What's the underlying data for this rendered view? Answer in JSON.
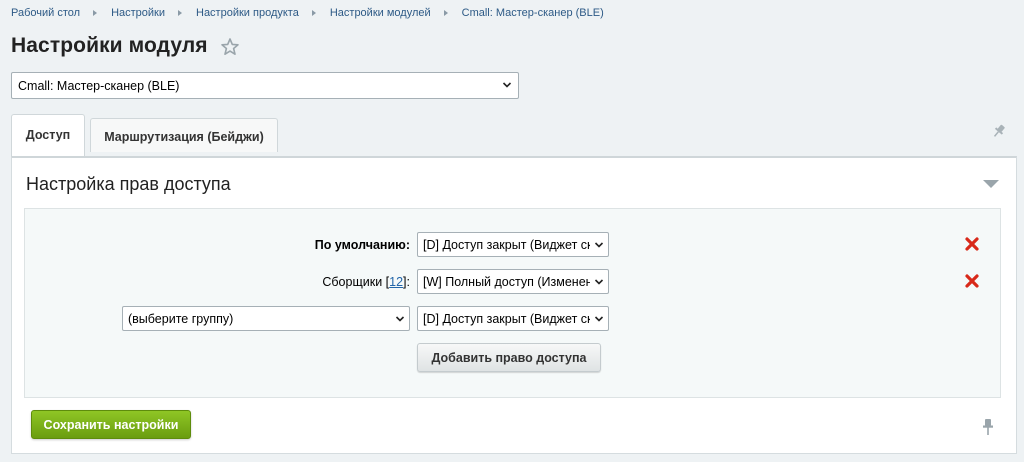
{
  "breadcrumbs": [
    "Рабочий стол",
    "Настройки",
    "Настройки продукта",
    "Настройки модулей",
    "Cmall: Мастер-сканер (BLE)"
  ],
  "page_title": "Настройки модуля",
  "module_select": {
    "value": "Cmall: Мастер-сканер (BLE)"
  },
  "tabs": [
    {
      "label": "Доступ",
      "active": true
    },
    {
      "label": "Маршрутизация (Бейджи)",
      "active": false
    }
  ],
  "section": {
    "title": "Настройка прав доступа",
    "rows": [
      {
        "label": "По умолчанию:",
        "value": "[D] Доступ закрыт (Виджет ск"
      },
      {
        "label_prefix": "Сборщики [",
        "label_link": "12",
        "label_suffix": "]:",
        "value": "[W] Полный доступ (Изменен"
      },
      {
        "group_value": "(выберите группу)",
        "value": "[D] Доступ закрыт (Виджет ск"
      }
    ],
    "add_button": "Добавить право доступа"
  },
  "save_button": "Сохранить настройки",
  "colors": {
    "link": "#2d5a86",
    "save_green": "#7ab51b",
    "delete_red": "#d8291a"
  }
}
